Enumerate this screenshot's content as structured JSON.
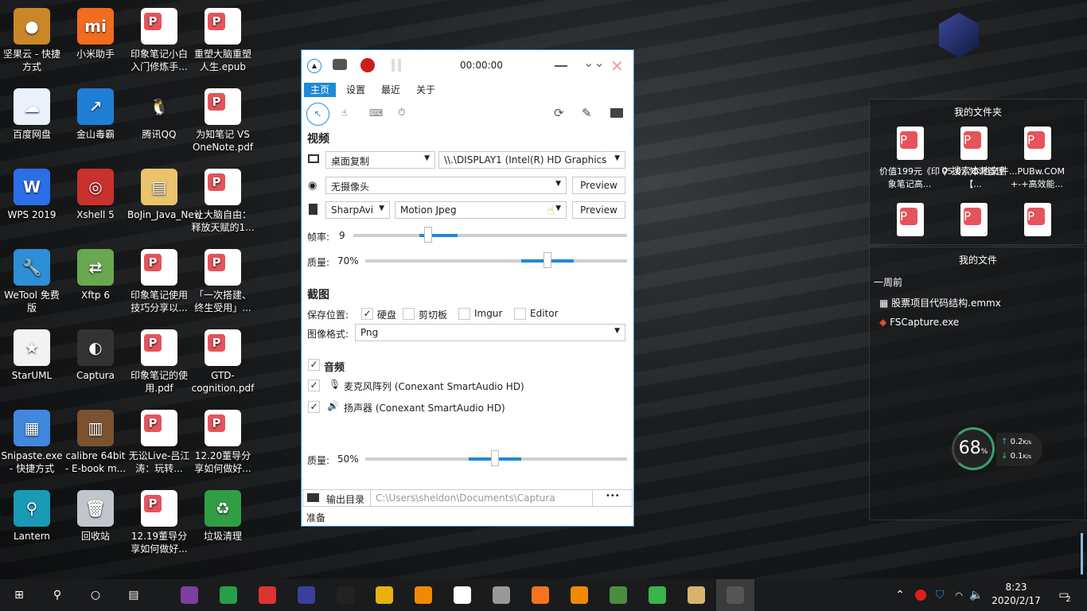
{
  "desktop_icons": [
    {
      "label": "坚果云 - 快捷方式",
      "color": "#c9872a",
      "glyph": "●"
    },
    {
      "label": "小米助手",
      "color": "#f26c1e",
      "glyph": "mi"
    },
    {
      "label": "印象笔记小白入门修炼手...",
      "color": "pdf",
      "glyph": ""
    },
    {
      "label": "重塑大脑重塑人生.epub",
      "color": "pdf",
      "glyph": ""
    },
    {
      "label": "百度网盘",
      "color": "#e9f1fb",
      "glyph": "☁"
    },
    {
      "label": "金山毒霸",
      "color": "#1f7fd6",
      "glyph": "↗"
    },
    {
      "label": "腾讯QQ",
      "color": "transparent",
      "glyph": "🐧"
    },
    {
      "label": "为知笔记 VS OneNote.pdf",
      "color": "pdf",
      "glyph": ""
    },
    {
      "label": "WPS 2019",
      "color": "#2b6fe6",
      "glyph": "W"
    },
    {
      "label": "Xshell 5",
      "color": "#c8312c",
      "glyph": "◎"
    },
    {
      "label": "BoJin_Java_New",
      "color": "#e9c46a",
      "glyph": "▤"
    },
    {
      "label": "让大脑自由：释放天赋的1...",
      "color": "pdf",
      "glyph": ""
    },
    {
      "label": "WeTool 免费版",
      "color": "#2d8fd5",
      "glyph": "🔧"
    },
    {
      "label": "Xftp 6",
      "color": "#6aa84f",
      "glyph": "⇄"
    },
    {
      "label": "印象笔记使用技巧分享以...",
      "color": "pdf",
      "glyph": ""
    },
    {
      "label": "「一次搭建、终生受用」...",
      "color": "pdf",
      "glyph": ""
    },
    {
      "label": "StarUML",
      "color": "#f2f2f2",
      "glyph": "★"
    },
    {
      "label": "Captura",
      "color": "#333",
      "glyph": "◐"
    },
    {
      "label": "印象笔记的使用.pdf",
      "color": "pdf",
      "glyph": ""
    },
    {
      "label": "GTD-cognition.pdf",
      "color": "pdf",
      "glyph": ""
    },
    {
      "label": "Snipaste.exe - 快捷方式",
      "color": "#3f88de",
      "glyph": "▦"
    },
    {
      "label": "calibre 64bit - E-book m...",
      "color": "#7a5230",
      "glyph": "▥"
    },
    {
      "label": "无讼Live-吕江涛：玩转...",
      "color": "pdf",
      "glyph": ""
    },
    {
      "label": "12.20董导分享如何做好...",
      "color": "pdf",
      "glyph": ""
    },
    {
      "label": "Lantern",
      "color": "#1a9bb5",
      "glyph": "⚲"
    },
    {
      "label": "回收站",
      "color": "#c0c6cc",
      "glyph": "🗑"
    },
    {
      "label": "12.19董导分享如何做好...",
      "color": "pdf",
      "glyph": ""
    },
    {
      "label": "垃圾清理",
      "color": "#2f9e44",
      "glyph": "♻"
    }
  ],
  "captura": {
    "timer": "00:00:00",
    "tabs": [
      "主页",
      "设置",
      "最近",
      "关于"
    ],
    "video_heading": "视频",
    "source": "桌面复制",
    "display": "\\\\.\\DISPLAY1 (Intel(R) HD Graphics",
    "webcam": "无摄像头",
    "preview1": "Preview",
    "writer": "SharpAvi",
    "codec": "Motion Jpeg",
    "preview2": "Preview",
    "fps_label": "帧率:",
    "fps": "9",
    "fps_fraction": 0.25,
    "quality_label": "质量:",
    "quality": "70%",
    "quality_fraction": 0.7,
    "screenshot_heading": "截图",
    "save_label": "保存位置:",
    "save_targets": [
      {
        "label": "硬盘",
        "checked": true
      },
      {
        "label": "剪切板",
        "checked": false
      },
      {
        "label": "Imgur",
        "checked": false
      },
      {
        "label": "Editor",
        "checked": false
      }
    ],
    "format_label": "图像格式:",
    "format": "Png",
    "audio_heading": "音频",
    "mic": "麦克风阵列 (Conexant SmartAudio HD)",
    "speaker": "扬声器 (Conexant SmartAudio HD)",
    "audio_quality_label": "质量:",
    "audio_quality": "50%",
    "audio_quality_fraction": 0.5,
    "output_label": "输出目录",
    "output_path": "C:\\Users\\sheldon\\Documents\\Captura",
    "more": "•••",
    "status": "准备"
  },
  "fences": {
    "folder_title": "我的文件夹",
    "search": "搜索本地文件",
    "files": [
      "价值199元《印象笔记高...",
      "05.0...知识管理【...",
      "...PUBw.COM +-+高效能..."
    ],
    "my_files_title": "我的文件",
    "group": "一周前",
    "recent": [
      "股票项目代码结构.emmx",
      "FSCapture.exe"
    ]
  },
  "widget": {
    "percent": "68",
    "percent_unit": "%",
    "up": "0.2",
    "down": "0.1",
    "unit": "K/s"
  },
  "taskbar": {
    "apps": [
      "OneNote",
      "Evernote",
      "IntelliJ IDEA",
      "Eclipse",
      "DataGrip",
      "Chrome",
      "VLC",
      "DaVinci",
      "Network",
      "Office",
      "Search",
      "Charts",
      "WeChat",
      "Book",
      "Captura"
    ],
    "time": "8:23",
    "date": "2020/2/17",
    "notifications": "2"
  }
}
